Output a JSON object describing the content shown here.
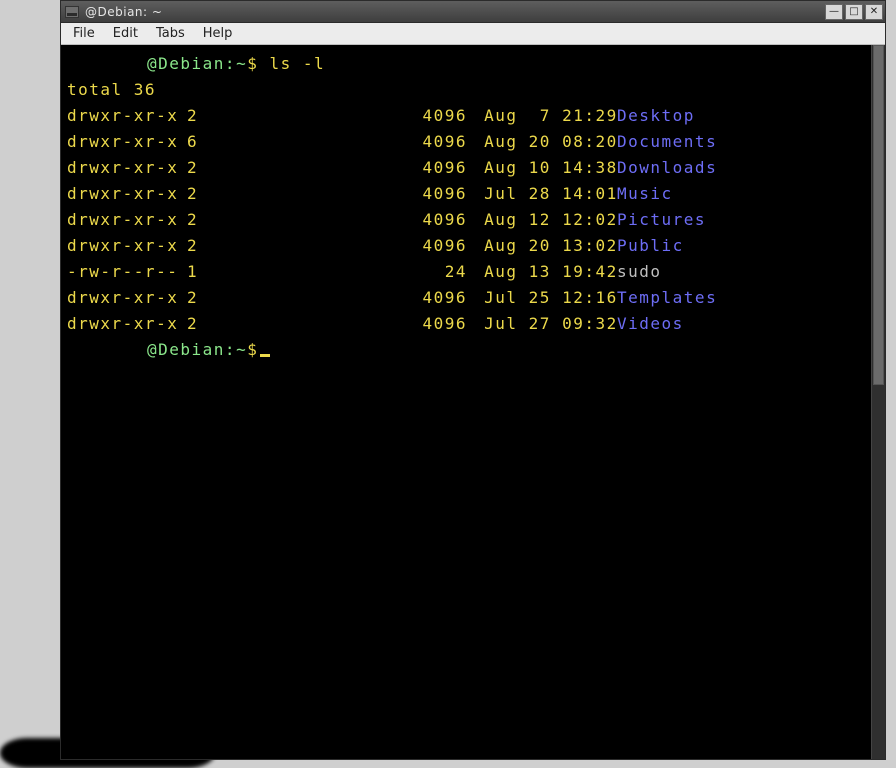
{
  "window": {
    "title": "     @Debian: ~"
  },
  "menu": {
    "file": "File",
    "edit": "Edit",
    "tabs": "Tabs",
    "help": "Help"
  },
  "win_controls": {
    "minimize": "—",
    "maximize": "□",
    "close": "✕"
  },
  "prompt": {
    "user_host": "@Debian:",
    "path": "~",
    "symbol": "$"
  },
  "command": "ls -l",
  "total_line": "total 36",
  "listing": [
    {
      "perm": "drwxr-xr-x",
      "links": "2",
      "size": "4096",
      "date": "Aug  7 21:29",
      "name": "Desktop",
      "is_dir": true
    },
    {
      "perm": "drwxr-xr-x",
      "links": "6",
      "size": "4096",
      "date": "Aug 20 08:20",
      "name": "Documents",
      "is_dir": true
    },
    {
      "perm": "drwxr-xr-x",
      "links": "2",
      "size": "4096",
      "date": "Aug 10 14:38",
      "name": "Downloads",
      "is_dir": true
    },
    {
      "perm": "drwxr-xr-x",
      "links": "2",
      "size": "4096",
      "date": "Jul 28 14:01",
      "name": "Music",
      "is_dir": true
    },
    {
      "perm": "drwxr-xr-x",
      "links": "2",
      "size": "4096",
      "date": "Aug 12 12:02",
      "name": "Pictures",
      "is_dir": true
    },
    {
      "perm": "drwxr-xr-x",
      "links": "2",
      "size": "4096",
      "date": "Aug 20 13:02",
      "name": "Public",
      "is_dir": true
    },
    {
      "perm": "-rw-r--r--",
      "links": "1",
      "size": "24",
      "date": "Aug 13 19:42",
      "name": "sudo",
      "is_dir": false
    },
    {
      "perm": "drwxr-xr-x",
      "links": "2",
      "size": "4096",
      "date": "Jul 25 12:16",
      "name": "Templates",
      "is_dir": true
    },
    {
      "perm": "drwxr-xr-x",
      "links": "2",
      "size": "4096",
      "date": "Jul 27 09:32",
      "name": "Videos",
      "is_dir": true
    }
  ]
}
